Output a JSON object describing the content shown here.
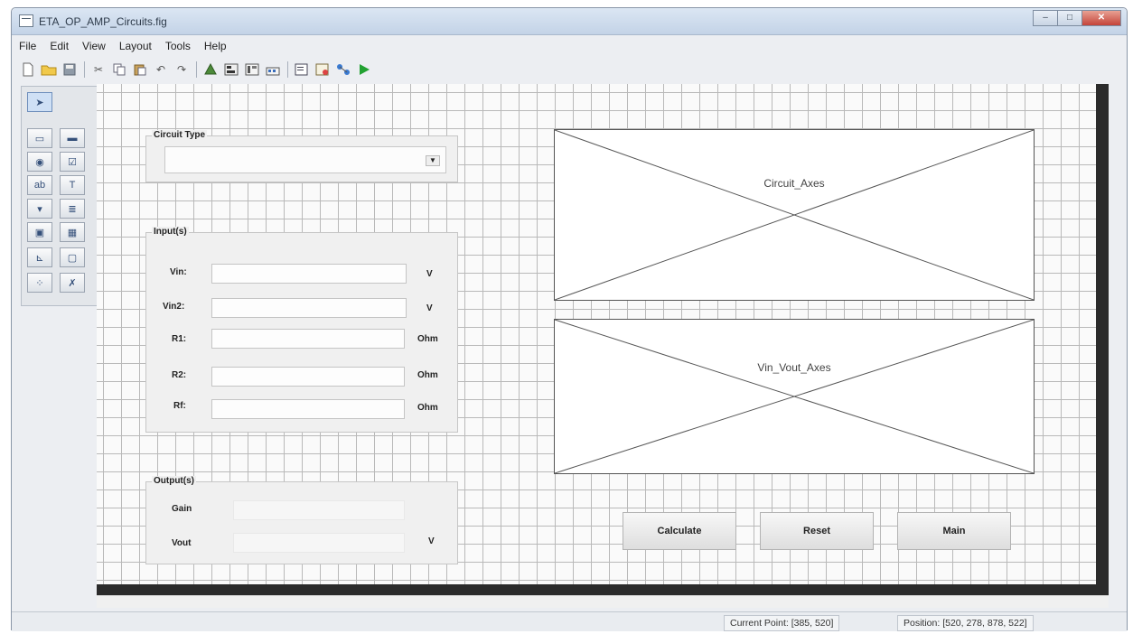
{
  "window": {
    "title": "ETA_OP_AMP_Circuits.fig"
  },
  "menubar": [
    "File",
    "Edit",
    "View",
    "Layout",
    "Tools",
    "Help"
  ],
  "canvas": {
    "circuit_panel": {
      "title": "Circuit Type"
    },
    "inputs_panel": {
      "title": "Input(s)",
      "rows": [
        {
          "label": "Vin:",
          "unit": "V"
        },
        {
          "label": "Vin2:",
          "unit": "V"
        },
        {
          "label": "R1:",
          "unit": "Ohm"
        },
        {
          "label": "R2:",
          "unit": "Ohm"
        },
        {
          "label": "Rf:",
          "unit": "Ohm"
        }
      ]
    },
    "outputs_panel": {
      "title": "Output(s)",
      "gain_label": "Gain",
      "vout_label": "Vout",
      "vout_unit": "V"
    },
    "axes": [
      "Circuit_Axes",
      "Vin_Vout_Axes"
    ],
    "buttons": {
      "calculate": "Calculate",
      "reset": "Reset",
      "main": "Main"
    }
  },
  "status": {
    "current_point": "Current Point: [385, 520]",
    "position": "Position: [520, 278, 878, 522]"
  }
}
